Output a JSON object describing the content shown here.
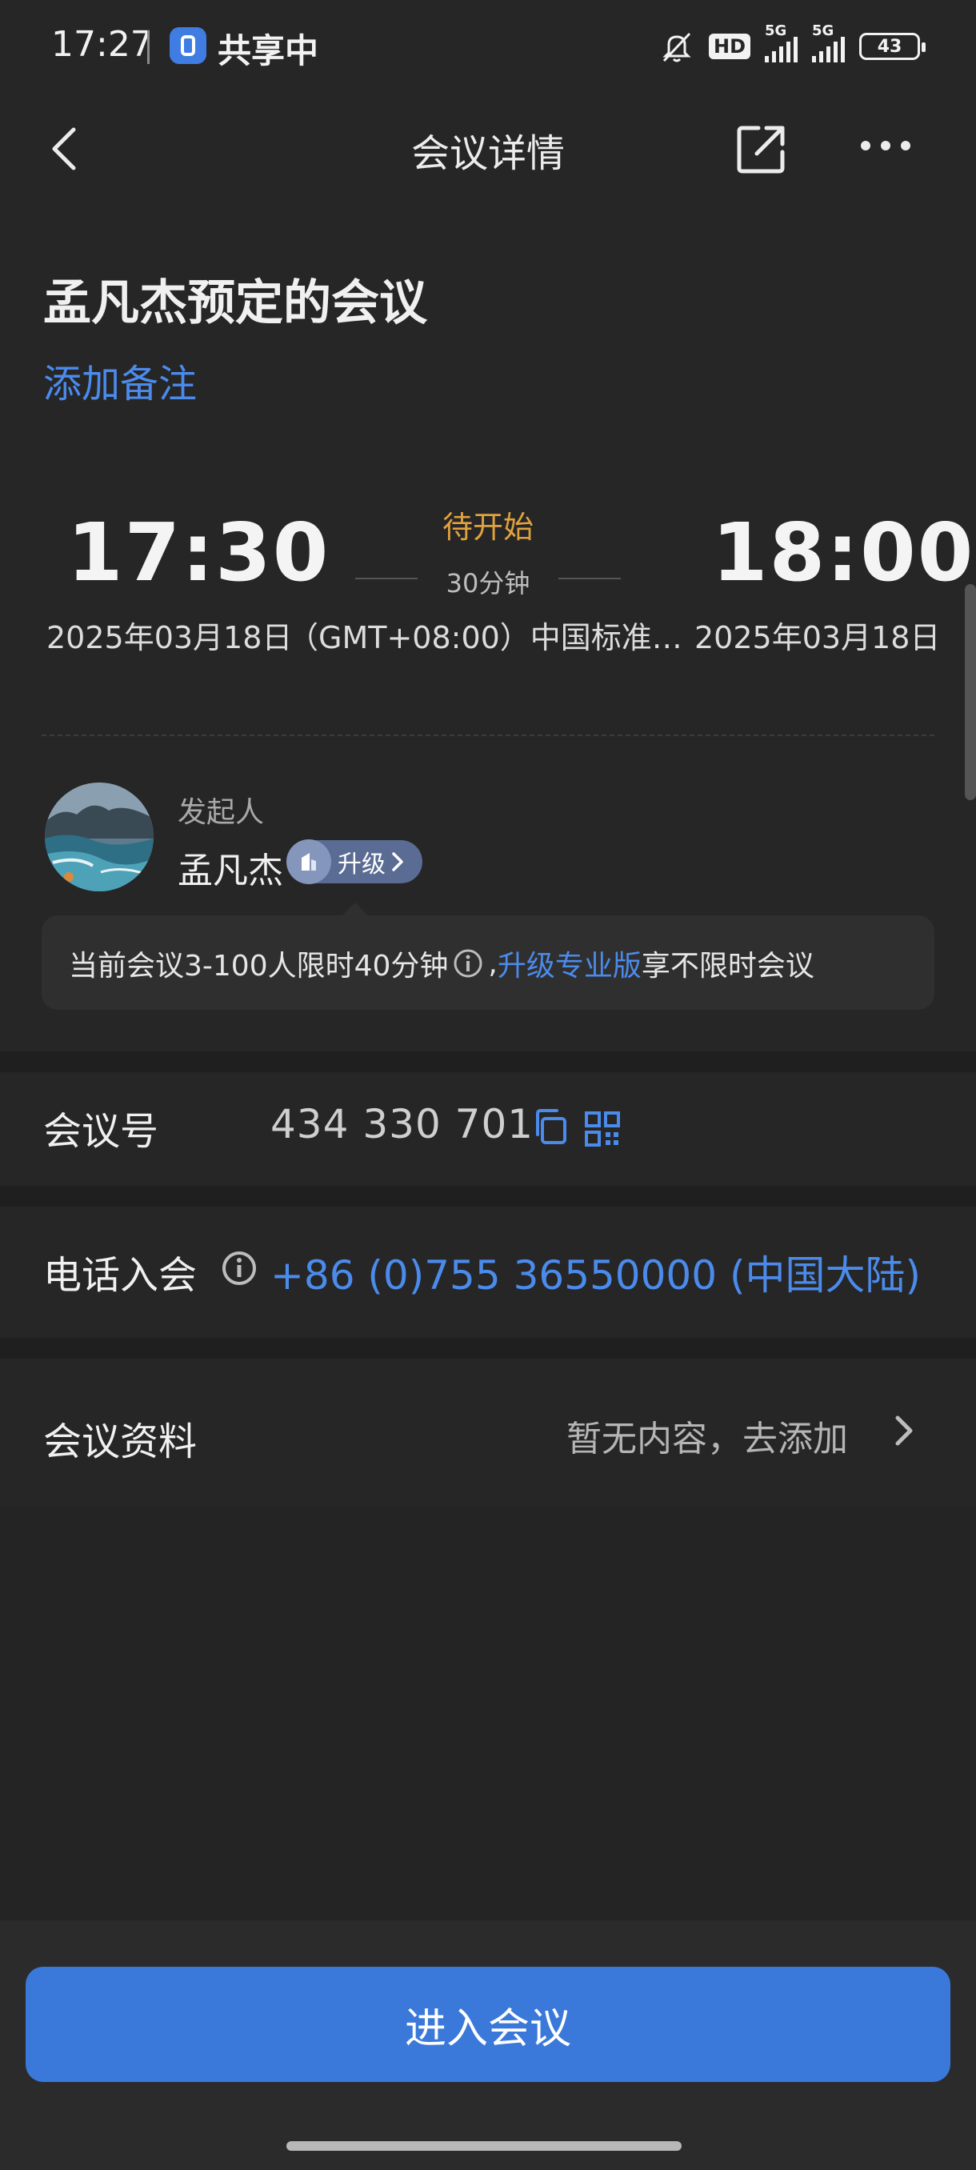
{
  "status_bar": {
    "time": "17:27",
    "sharing_label": "共享中",
    "hd_label": "HD",
    "network_1": "5G",
    "network_2": "5G",
    "battery": "43"
  },
  "nav": {
    "title": "会议详情"
  },
  "meeting": {
    "title": "孟凡杰预定的会议",
    "add_note": "添加备注",
    "status": "待开始",
    "duration": "30分钟",
    "start_time": "17:30",
    "end_time": "18:00",
    "start_date": "2025年03月18日",
    "timezone": "（GMT+08:00）中国标准…",
    "end_date": "2025年03月18日"
  },
  "host": {
    "label": "发起人",
    "name": "孟凡杰",
    "upgrade_label": "升级"
  },
  "tip": {
    "text_before": "当前会议3-100人限时40分钟",
    "comma": ",",
    "link": "升级专业版",
    "text_after": "享不限时会议"
  },
  "details": {
    "meeting_id_label": "会议号",
    "meeting_id": "434 330 701",
    "phone_label": "电话入会",
    "phone_number": "+86 (0)755 36550000 (中国大陆)",
    "materials_label": "会议资料",
    "materials_value": "暂无内容，去添加"
  },
  "actions": {
    "join_label": "进入会议"
  },
  "colors": {
    "background": "#262626",
    "accent_blue": "#4b8bec",
    "status_orange": "#e0a23e",
    "button_blue": "#3a78d9"
  }
}
